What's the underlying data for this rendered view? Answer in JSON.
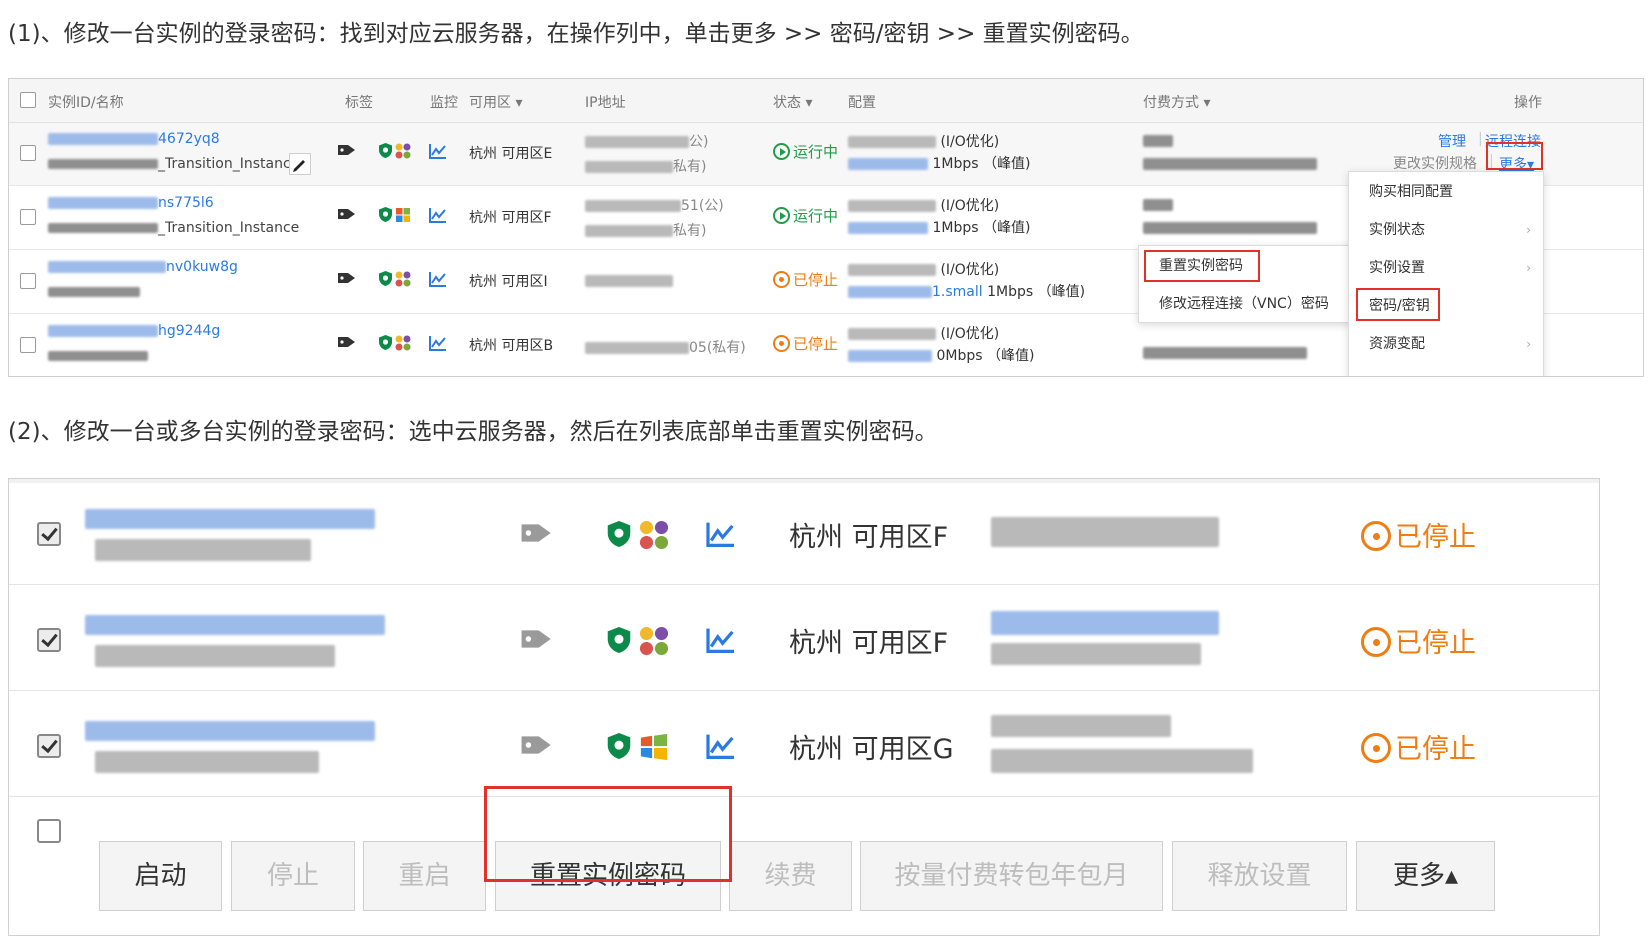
{
  "step1": "(1)、修改一台实例的登录密码：找到对应云服务器，在操作列中，单击更多 >> 密码/密钥 >> 重置实例密码。",
  "step2": "(2)、修改一台或多台实例的登录密码：选中云服务器，然后在列表底部单击重置实例密码。",
  "panel1": {
    "headers": {
      "id": "实例ID/名称",
      "tag": "标签",
      "monitor": "监控",
      "zone": "可用区",
      "ip": "IP地址",
      "status": "状态",
      "config": "配置",
      "payment": "付费方式",
      "ops": "操作"
    },
    "header_dropdown_marker": "▾",
    "rows": [
      {
        "id_suffix": "4672yq8",
        "name": "Transition_Instance",
        "zone": "杭州 可用区E",
        "ip_public_label": "公)",
        "ip_private_label": "私有)",
        "status": "运行中",
        "status_type": "run",
        "io": "(I/O优化)",
        "bandwidth": "1Mbps （峰值)"
      },
      {
        "id_suffix": "ns775l6",
        "name": "Transition_Instance",
        "zone": "杭州 可用区F",
        "ip_public_label": "51(公)",
        "ip_private_label": "私有)",
        "status": "运行中",
        "status_type": "run",
        "io": "(I/O优化)",
        "bandwidth": "1Mbps （峰值)"
      },
      {
        "id_suffix": "nv0kuw8g",
        "name": "",
        "zone": "杭州 可用区I",
        "ip_public_label": "",
        "ip_private_label": "",
        "status": "已停止",
        "status_type": "stop",
        "io": "(I/O优化)",
        "instance_type_suffix": "1.small",
        "bandwidth": "1Mbps （峰值)"
      },
      {
        "id_suffix": "hg9244g",
        "name": "",
        "zone": "杭州 可用区B",
        "ip_public_label": "",
        "ip_private_label": "05(私有)",
        "status": "已停止",
        "status_type": "stop",
        "io": "(I/O优化)",
        "bandwidth": "0Mbps （峰值)"
      }
    ],
    "ops": {
      "manage": "管理",
      "separator": "|",
      "remote": "远程连接",
      "change_spec": "更改实例规格",
      "more": "更多",
      "more_marker": "▾"
    },
    "more_menu": [
      {
        "label": "购买相同配置",
        "has_sub": false
      },
      {
        "label": "实例状态",
        "has_sub": true
      },
      {
        "label": "实例设置",
        "has_sub": true
      },
      {
        "label": "密码/密钥",
        "has_sub": false
      },
      {
        "label": "资源变配",
        "has_sub": true
      }
    ],
    "submenu_arrow": "›",
    "password_submenu": [
      "重置实例密码",
      "修改远程连接（VNC）密码"
    ]
  },
  "panel2": {
    "rows": [
      {
        "zone": "杭州 可用区F",
        "status": "已停止",
        "os": "linux"
      },
      {
        "zone": "杭州 可用区F",
        "status": "已停止",
        "os": "linux"
      },
      {
        "zone": "杭州 可用区G",
        "status": "已停止",
        "os": "windows"
      }
    ],
    "buttons": [
      {
        "label": "启动",
        "enabled": true
      },
      {
        "label": "停止",
        "enabled": false
      },
      {
        "label": "重启",
        "enabled": false
      },
      {
        "label": "重置实例密码",
        "enabled": true
      },
      {
        "label": "续费",
        "enabled": false
      },
      {
        "label": "按量付费转包年包月",
        "enabled": false
      },
      {
        "label": "释放设置",
        "enabled": false
      },
      {
        "label": "更多▴",
        "enabled": true
      }
    ]
  },
  "colors": {
    "link": "#2a7ae2",
    "running": "#1e9e4a",
    "stopped": "#f07d12",
    "highlight_box": "#e0312b",
    "shield": "#0c8a4a"
  }
}
